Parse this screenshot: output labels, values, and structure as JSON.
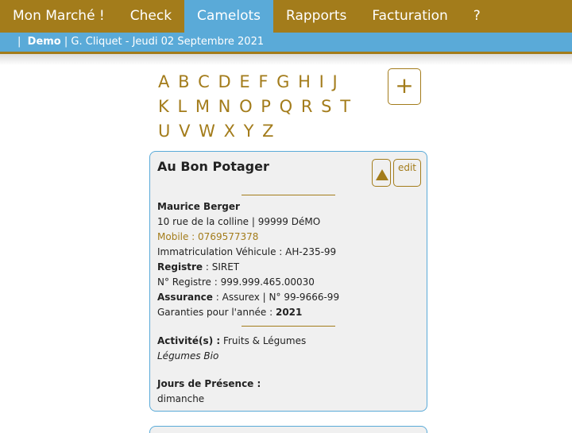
{
  "nav": {
    "items": [
      {
        "label": "Mon Marché !",
        "active": false
      },
      {
        "label": "Check",
        "active": false
      },
      {
        "label": "Camelots",
        "active": true
      },
      {
        "label": "Rapports",
        "active": false
      },
      {
        "label": "Facturation",
        "active": false
      },
      {
        "label": "?",
        "active": false
      }
    ]
  },
  "subbar": {
    "separator": "|",
    "market": "Demo",
    "info": "| G. Cliquet - Jeudi 02 Septembre 2021"
  },
  "alphabet": {
    "rows": [
      [
        "A",
        "B",
        "C",
        "D",
        "E",
        "F",
        "G",
        "H",
        "I",
        "J"
      ],
      [
        "K",
        "L",
        "M",
        "N",
        "O",
        "P",
        "Q",
        "R",
        "S",
        "T"
      ],
      [
        "U",
        "V",
        "W",
        "X",
        "Y",
        "Z"
      ]
    ]
  },
  "add_button": {
    "label": "+"
  },
  "card": {
    "title": "Au Bon Potager",
    "edit_label": "edit",
    "owner": "Maurice Berger",
    "address": "10 rue de la colline | 99999 DéMO",
    "mobile_label": "Mobile : ",
    "mobile": "0769577378",
    "vehicle": "Immatriculation Véhicule : AH-235-99",
    "registre_label": "Registre",
    "registre_value": " : SIRET",
    "registre_num": "N° Registre : 999.999.465.00030",
    "assurance_label": "Assurance",
    "assurance_value": " : Assurex | N° 99-9666-99",
    "garanties_label": "Garanties pour l'année : ",
    "garanties_year": "2021",
    "activites_label": "Activité(s) :",
    "activites_value": " Fruits & Légumes",
    "activites_sub": "Légumes Bio",
    "presence_label": "Jours de Présence :",
    "presence_value": "dimanche"
  },
  "colors": {
    "brand": "#a37c1b",
    "accent": "#5aaad8"
  }
}
